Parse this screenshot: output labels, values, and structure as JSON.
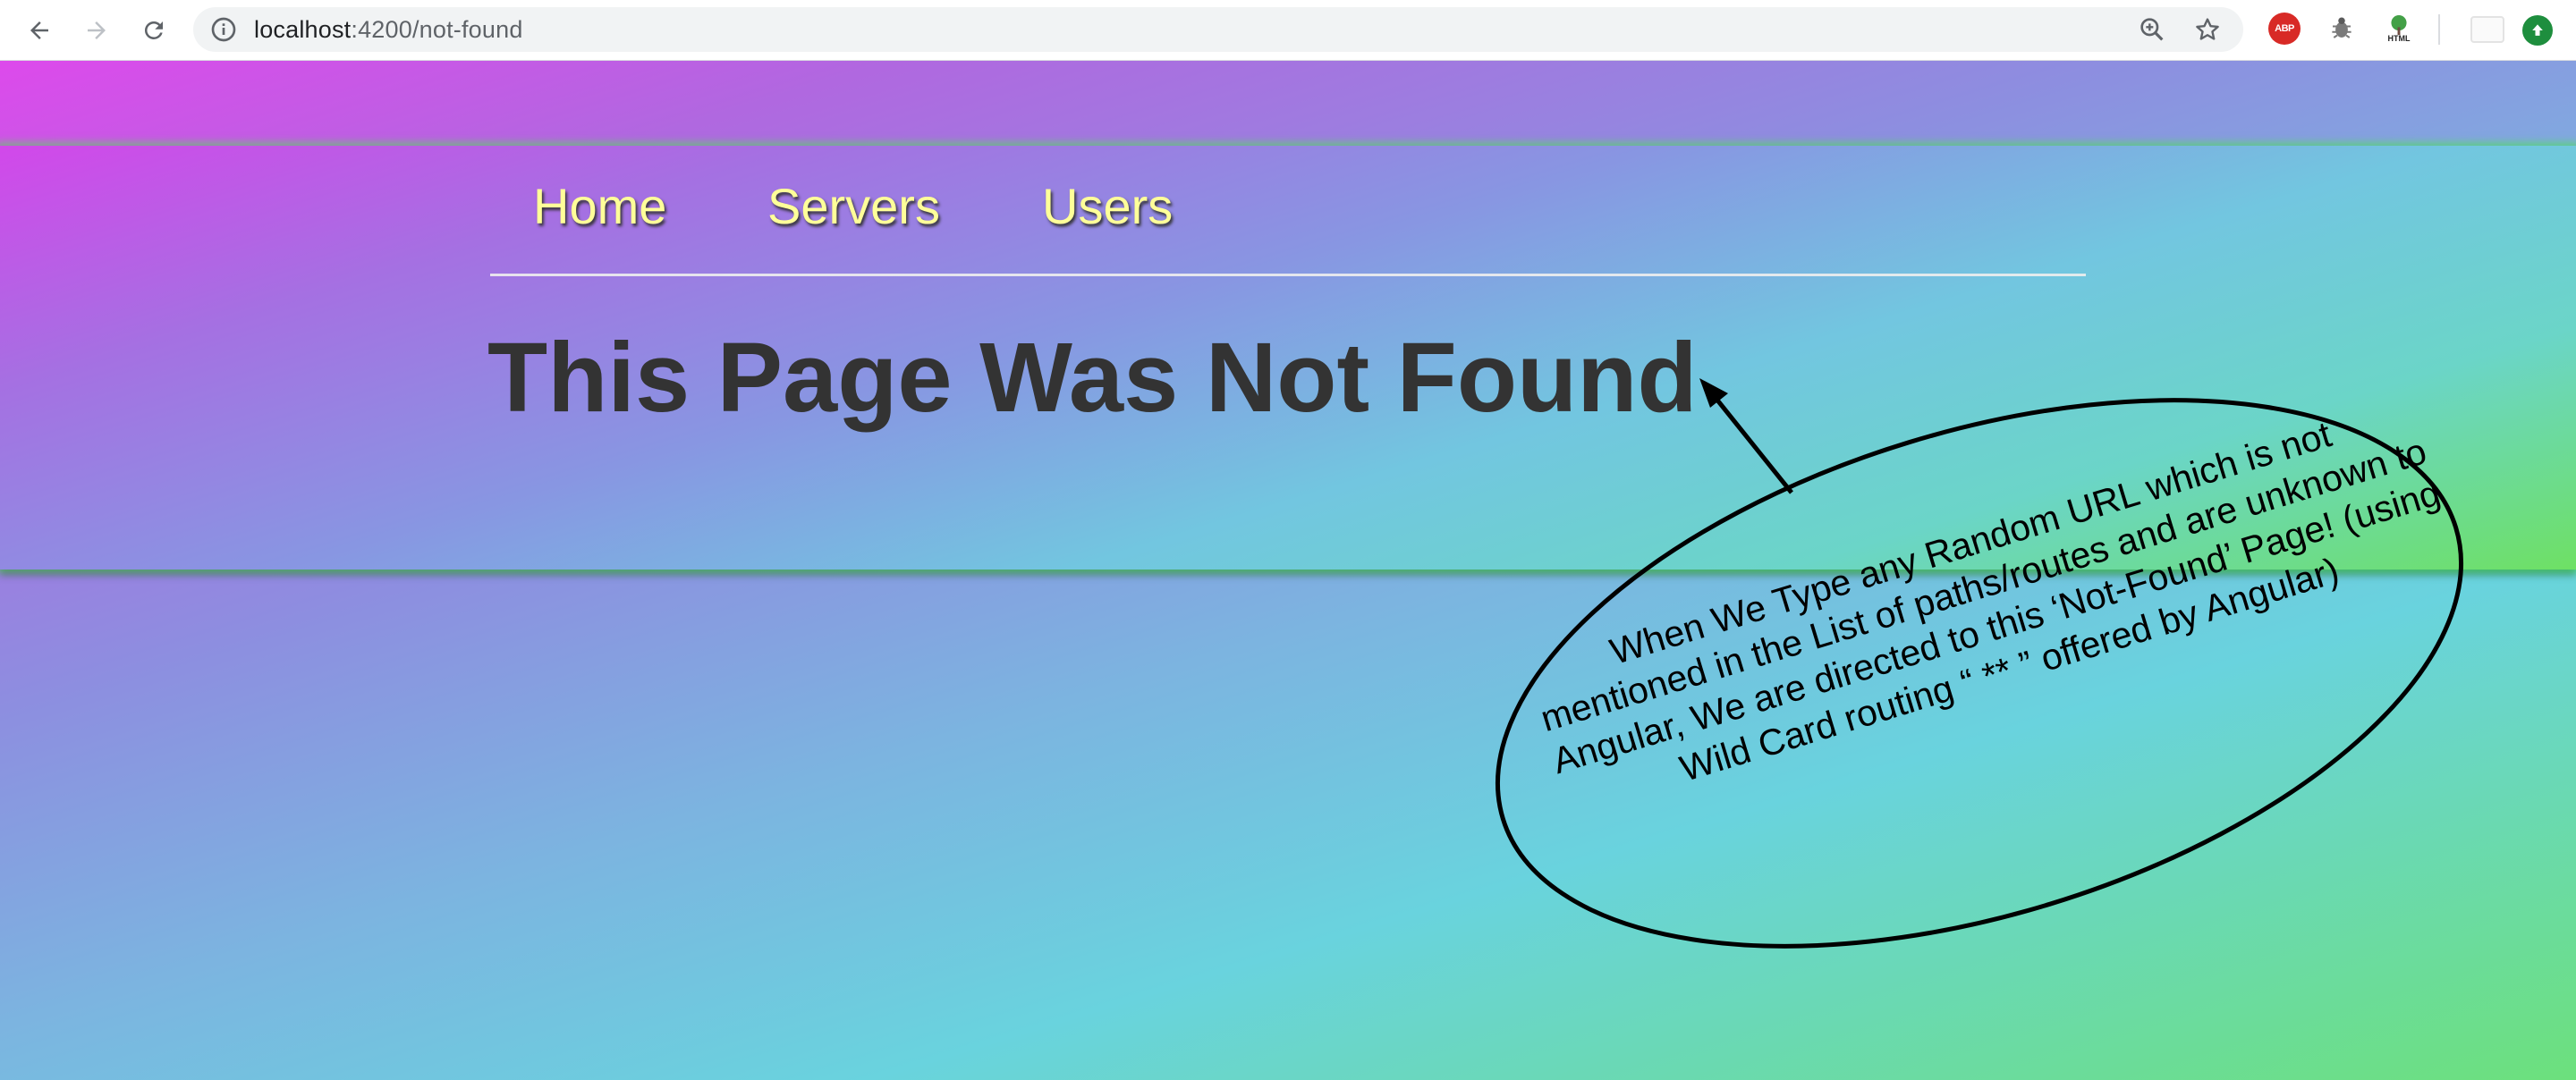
{
  "browser": {
    "url_host": "localhost",
    "url_rest": ":4200/not-found",
    "extensions": {
      "adblock_label": "ABP",
      "html_label": "HTML"
    }
  },
  "nav": {
    "links": [
      {
        "label": "Home"
      },
      {
        "label": "Servers"
      },
      {
        "label": "Users"
      }
    ]
  },
  "page": {
    "title": "This Page Was Not Found"
  },
  "annotation": {
    "lines": [
      "When We Type any Random URL which is not",
      "mentioned in the List of paths/routes and are unknown to",
      "Angular, We are directed to this ‘Not-Found’ Page! (using",
      "Wild Card routing “ ** ” offered by Angular)"
    ]
  },
  "colors": {
    "nav_link": "#ffff99",
    "title": "#333333",
    "gradient_start": "#e743ee",
    "gradient_mid": "#69d3de",
    "gradient_end": "#6ce07c"
  }
}
